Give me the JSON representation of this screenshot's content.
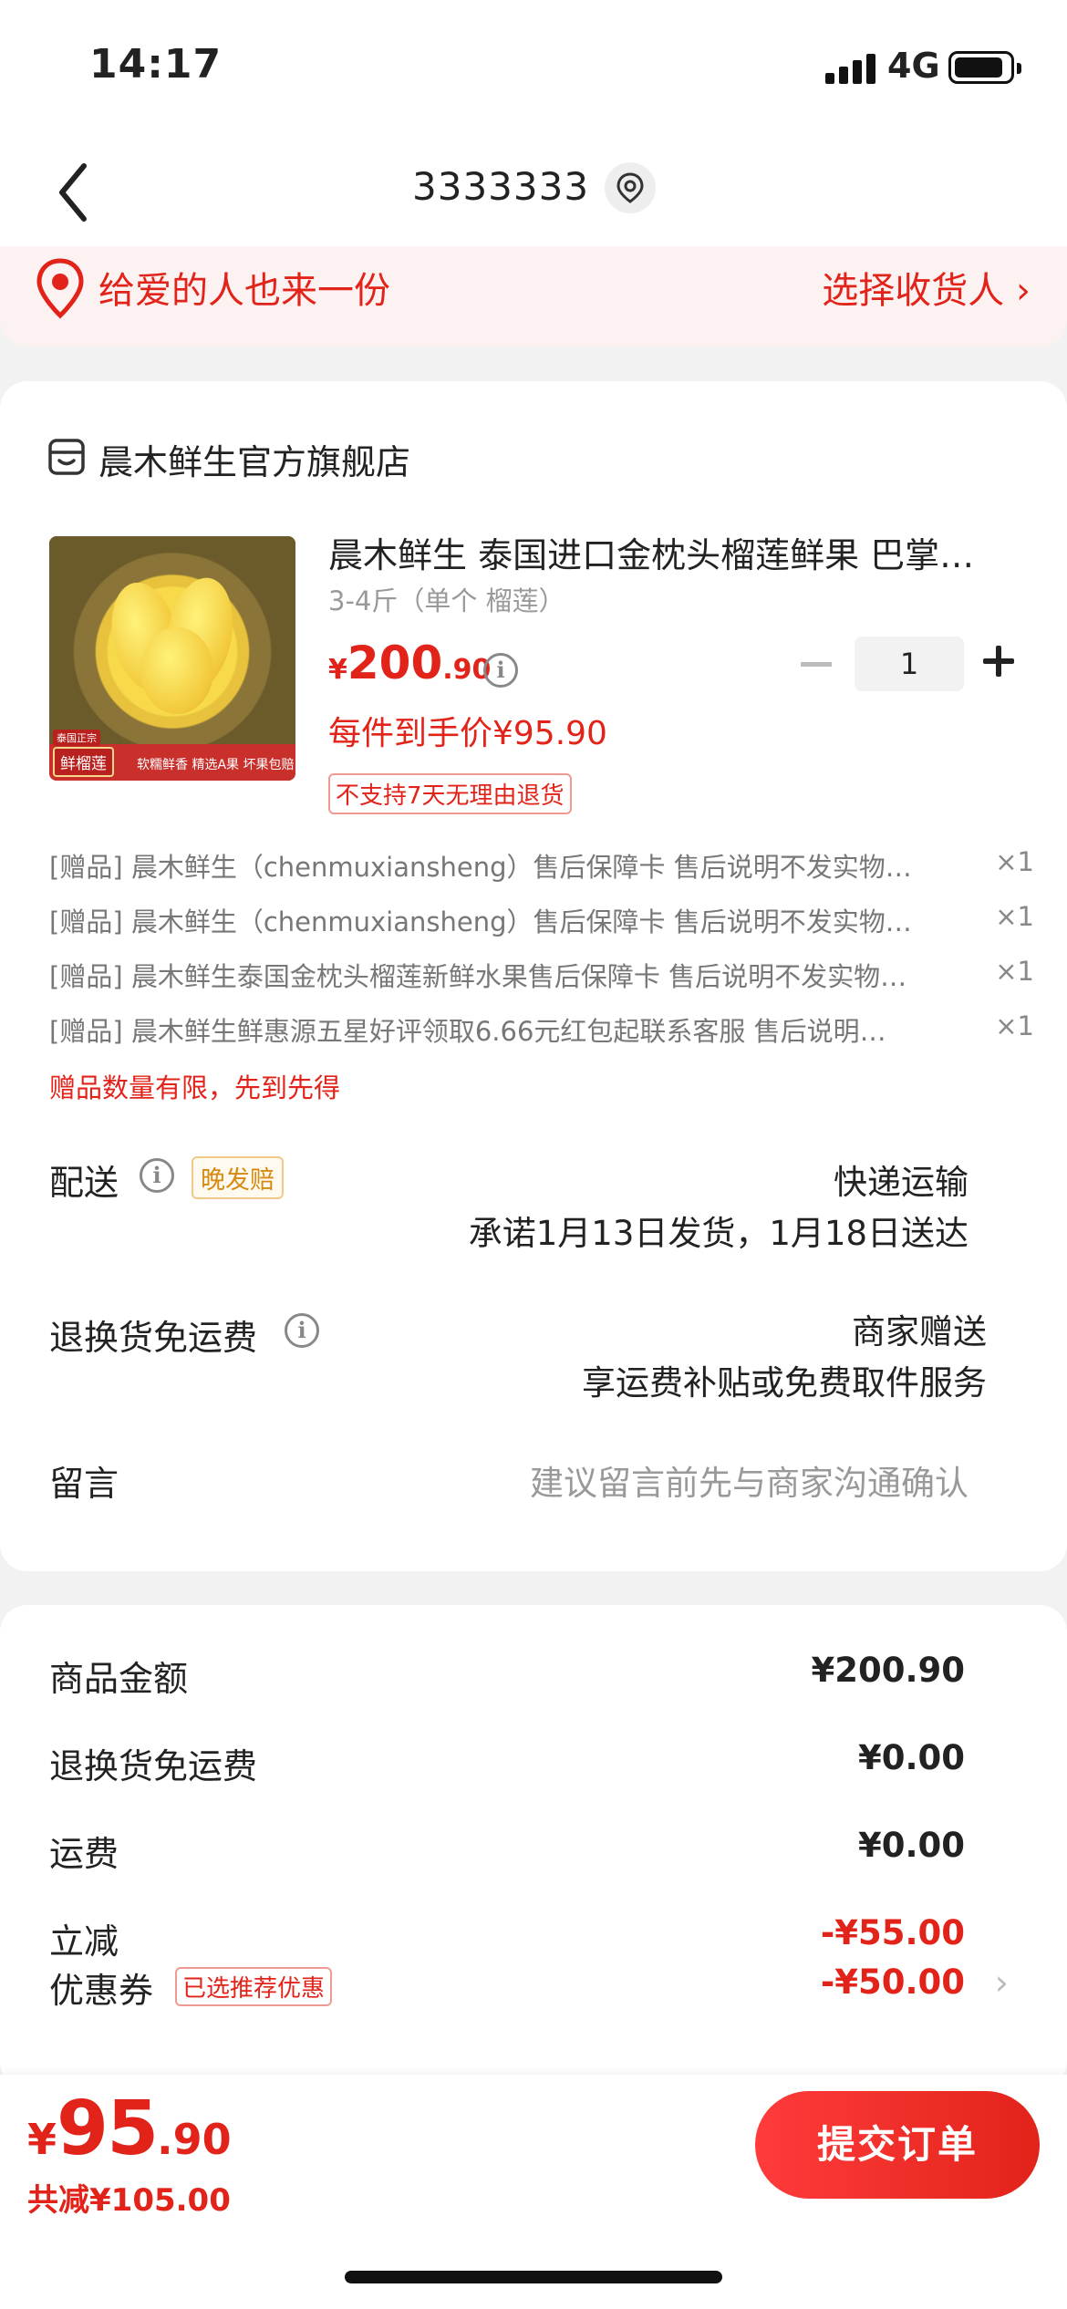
{
  "status": {
    "time": "14:17",
    "network": "4G"
  },
  "nav": {
    "title": "3333333"
  },
  "gift_banner": {
    "text": "给爱的人也来一份",
    "action": "选择收货人 ›"
  },
  "shop": {
    "name": "晨木鲜生官方旗舰店"
  },
  "product": {
    "title": "晨木鲜生 泰国进口金枕头榴莲鲜果 巴掌…",
    "spec": "3-4斤（单个 榴莲）",
    "price_symbol": "¥",
    "price_int": "200",
    "price_dec": ".90",
    "quantity": "1",
    "unit_price": "每件到手价¥95.90",
    "no_return": "不支持7天无理由退货",
    "image_badge_top": "泰国正宗",
    "image_badge_main": "鲜榴莲",
    "image_badge_sub": "软糯鲜香 精选A果 坏果包赔"
  },
  "gifts": [
    {
      "text": "[赠品] 晨木鲜生（chenmuxiansheng）售后保障卡 售后说明不发实物…",
      "count": "×1"
    },
    {
      "text": "[赠品] 晨木鲜生（chenmuxiansheng）售后保障卡 售后说明不发实物…",
      "count": "×1"
    },
    {
      "text": "[赠品] 晨木鲜生泰国金枕头榴莲新鲜水果售后保障卡 售后说明不发实物…",
      "count": "×1"
    },
    {
      "text": "[赠品] 晨木鲜生鲜惠源五星好评领取6.66元红包起联系客服  售后说明…",
      "count": "×1"
    }
  ],
  "gift_limit": "赠品数量有限，先到先得",
  "delivery": {
    "label": "配送",
    "badge": "晚发赔",
    "method": "快递运输",
    "promise": "承诺1月13日发货，1月18日送达"
  },
  "return_shipping": {
    "label": "退换货免运费",
    "value": "商家赠送",
    "desc": "享运费补贴或免费取件服务"
  },
  "message": {
    "label": "留言",
    "placeholder": "建议留言前先与商家沟通确认"
  },
  "summary": [
    {
      "label": "商品金额",
      "value": "¥200.90"
    },
    {
      "label": "退换货免运费",
      "value": "¥0.00"
    },
    {
      "label": "运费",
      "value": "¥0.00"
    },
    {
      "label": "立减",
      "value": "-¥55.00"
    },
    {
      "label": "优惠券",
      "value": "-¥50.00"
    }
  ],
  "coupon_badge": "已选推荐优惠",
  "bottom": {
    "total_symbol": "¥",
    "total_int": "95",
    "total_dec": ".90",
    "saved": "共减¥105.00",
    "submit": "提交订单"
  },
  "colors": {
    "accent": "#e2231a",
    "banner_bg": "#fdf2f2",
    "page_bg": "#f2f2f2"
  }
}
